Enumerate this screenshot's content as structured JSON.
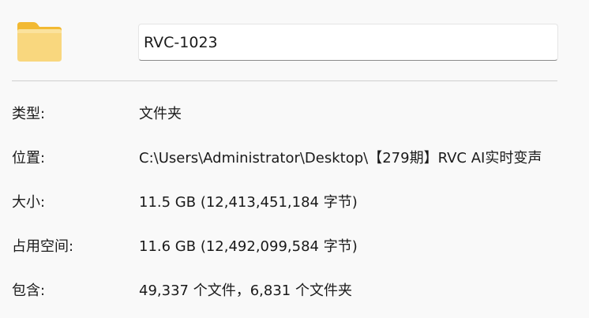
{
  "general": {
    "icon": "folder-icon",
    "name_value": "RVC-1023"
  },
  "properties": {
    "type": {
      "label": "类型:",
      "value": "文件夹"
    },
    "location": {
      "label": "位置:",
      "value": "C:\\Users\\Administrator\\Desktop\\【279期】RVC AI实时变声"
    },
    "size": {
      "label": "大小:",
      "value": "11.5 GB (12,413,451,184 字节)"
    },
    "size_on_disk": {
      "label": "占用空间:",
      "value": "11.6 GB (12,492,099,584 字节)"
    },
    "contains": {
      "label": "包含:",
      "value": "49,337 个文件，6,831 个文件夹"
    }
  },
  "colors": {
    "background": "#f9f9f9",
    "folder_front": "#f9d77e",
    "folder_back": "#f2b932"
  }
}
